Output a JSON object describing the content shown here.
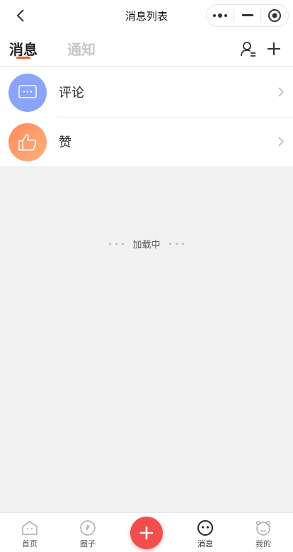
{
  "navbar": {
    "title": "消息列表",
    "back_icon": "chevron-left-icon",
    "capsule": [
      "more-dots-icon",
      "minimize-icon",
      "target-icon"
    ]
  },
  "tabs": [
    {
      "label": "消息",
      "active": true
    },
    {
      "label": "通知",
      "active": false
    }
  ],
  "header_actions": [
    "contacts-icon",
    "plus-icon"
  ],
  "accent_color": "#f25a2c",
  "list": [
    {
      "label": "评论",
      "icon": "comment-bubble-icon",
      "color": "#8aa4fb"
    },
    {
      "label": "赞",
      "icon": "thumbs-up-icon",
      "color": "#ff9a6a"
    }
  ],
  "loading_text": "加载中",
  "tabbar": [
    {
      "label": "首页",
      "icon": "home-icon",
      "active": false
    },
    {
      "label": "圈子",
      "icon": "compass-icon",
      "active": false
    },
    {
      "label": "消息",
      "icon": "message-face-icon",
      "active": true
    },
    {
      "label": "我的",
      "icon": "profile-face-icon",
      "active": false
    }
  ],
  "fab": {
    "icon": "plus-icon",
    "color": "#f44d4d"
  }
}
